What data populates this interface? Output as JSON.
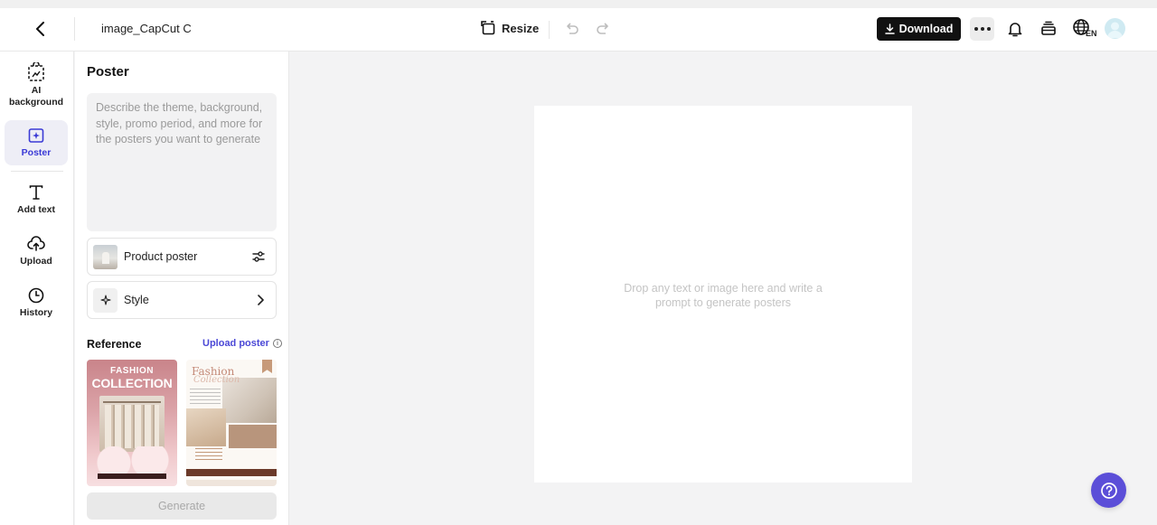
{
  "header": {
    "doc_title": "image_CapCut C",
    "resize_label": "Resize",
    "download_label": "Download",
    "language_code": "EN"
  },
  "rail": {
    "items": [
      {
        "label": "AI background",
        "icon": "ai-background-icon"
      },
      {
        "label": "Poster",
        "icon": "poster-icon",
        "active": true
      },
      {
        "label": "Add text",
        "icon": "text-icon"
      },
      {
        "label": "Upload",
        "icon": "upload-cloud-icon"
      },
      {
        "label": "History",
        "icon": "clock-icon"
      }
    ]
  },
  "panel": {
    "title": "Poster",
    "prompt_placeholder": "Describe the theme, background, style, promo period, and more for the posters you want to generate",
    "product_poster_label": "Product poster",
    "style_label": "Style",
    "reference_label": "Reference",
    "upload_poster_label": "Upload poster",
    "references": [
      {
        "line1": "FASHION",
        "line2": "COLLECTION"
      },
      {
        "line1": "Fashion",
        "line2": "Collection"
      }
    ],
    "generate_label": "Generate"
  },
  "canvas": {
    "drop_hint": "Drop any text or image here and write a prompt to generate posters"
  },
  "colors": {
    "accent": "#5b4ed8",
    "link": "#4b48d6",
    "download_bg": "#111111",
    "active_rail_bg": "#eeeef6"
  }
}
